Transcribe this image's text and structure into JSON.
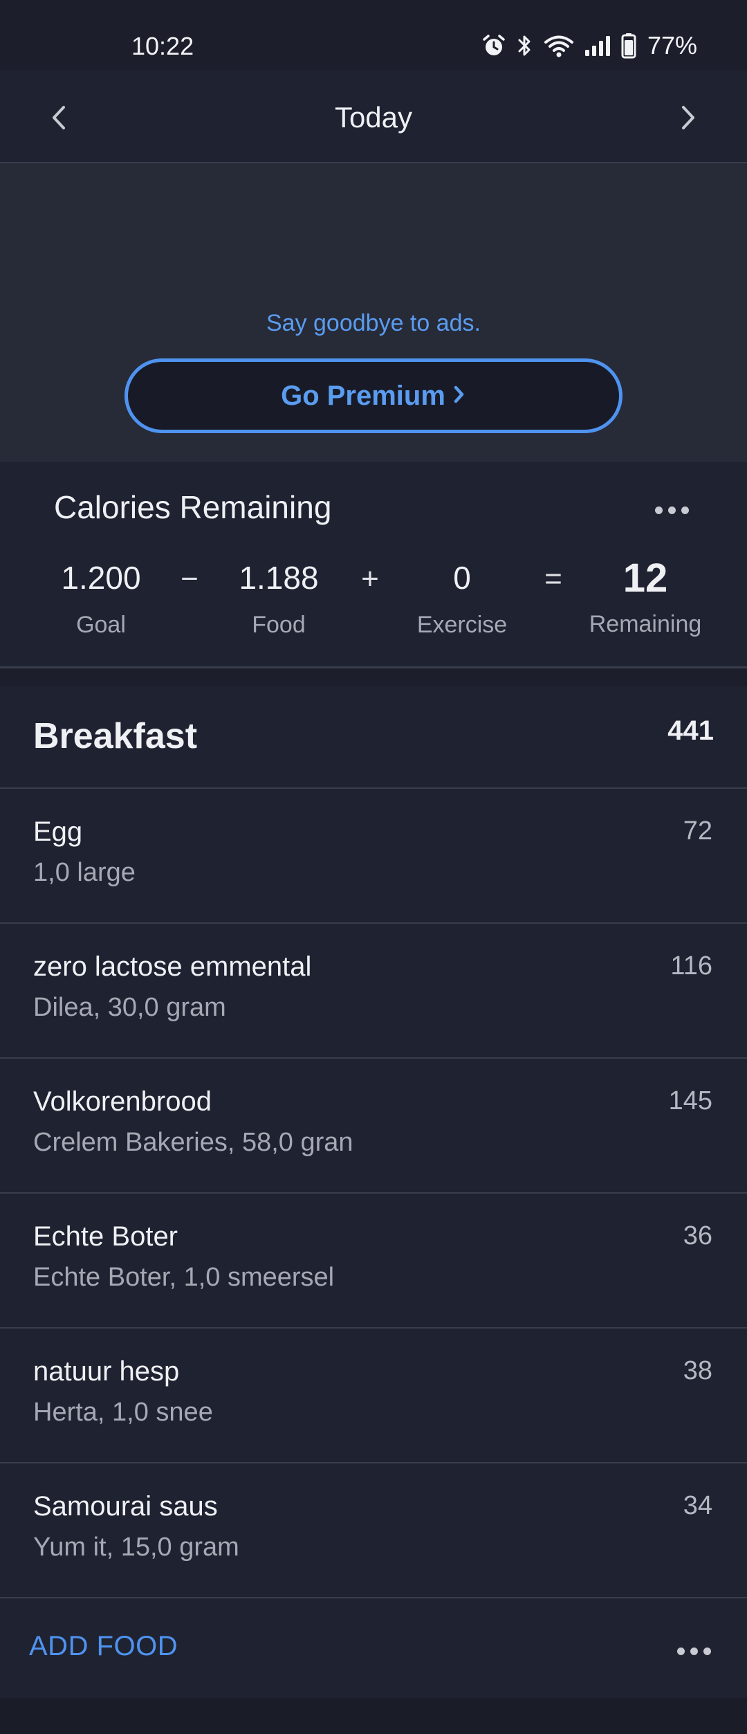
{
  "status_bar": {
    "time": "10:22",
    "battery": "77%",
    "icons": [
      "alarm-icon",
      "bluetooth-icon",
      "wifi-icon",
      "signal-icon",
      "battery-icon"
    ]
  },
  "nav": {
    "title": "Today",
    "prev_icon": "chevron-left-icon",
    "next_icon": "chevron-right-icon"
  },
  "ad": {
    "text": "Say goodbye to ads.",
    "button_label": "Go Premium"
  },
  "calories": {
    "title": "Calories Remaining",
    "goal_value": "1.200",
    "goal_label": "Goal",
    "minus": "−",
    "food_value": "1.188",
    "food_label": "Food",
    "plus": "+",
    "exercise_value": "0",
    "exercise_label": "Exercise",
    "equals": "=",
    "remaining_value": "12",
    "remaining_label": "Remaining"
  },
  "meal": {
    "title": "Breakfast",
    "total": "441",
    "items": [
      {
        "name": "Egg",
        "desc": "1,0 large",
        "calories": "72"
      },
      {
        "name": "zero lactose emmental",
        "desc": "Dilea, 30,0 gram",
        "calories": "116"
      },
      {
        "name": "Volkorenbrood",
        "desc": "Crelem Bakeries, 58,0 gran",
        "calories": "145"
      },
      {
        "name": "Echte Boter",
        "desc": "Echte Boter, 1,0 smeersel",
        "calories": "36"
      },
      {
        "name": "natuur hesp",
        "desc": "Herta, 1,0 snee",
        "calories": "38"
      },
      {
        "name": "Samourai saus",
        "desc": "Yum it, 15,0 gram",
        "calories": "34"
      }
    ],
    "add_food_label": "ADD FOOD"
  },
  "colors": {
    "background": "#1c1f2b",
    "accent": "#4f93f0",
    "text_primary": "#eef0f4",
    "text_secondary": "#a6a9b4"
  }
}
